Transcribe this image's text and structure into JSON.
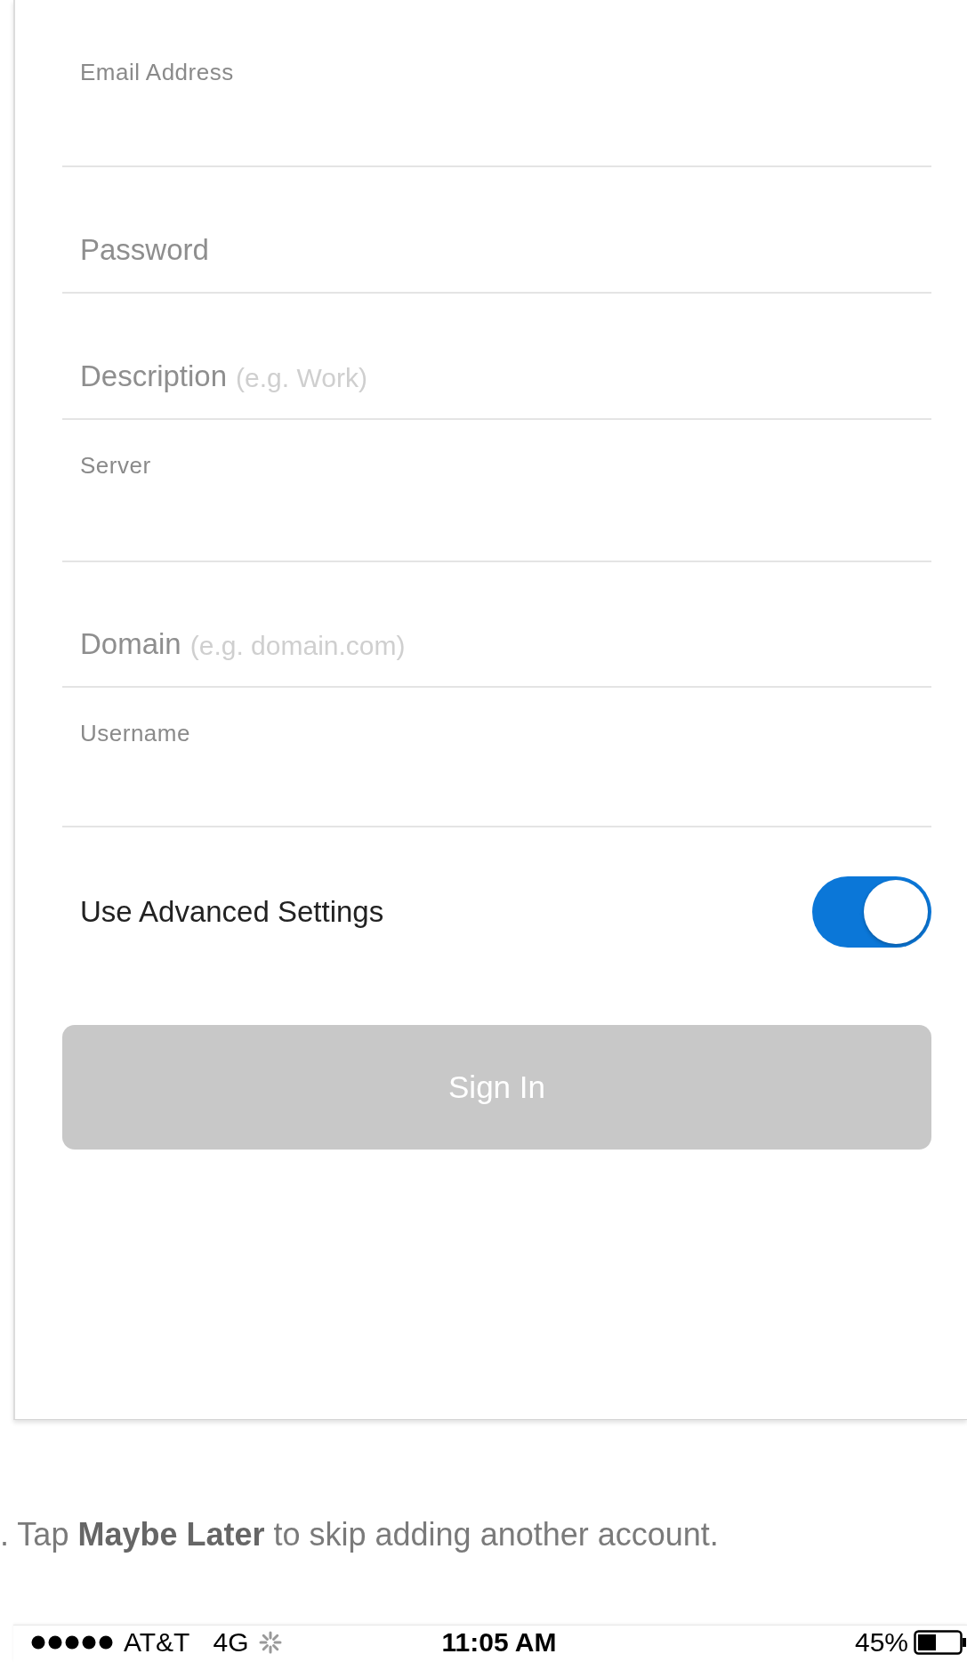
{
  "form": {
    "fields": [
      {
        "kind": "floating",
        "label": "Email Address"
      },
      {
        "kind": "placeholder",
        "placeholder": "Password"
      },
      {
        "kind": "placeholder",
        "placeholder": "Description",
        "hint": "(e.g. Work)"
      },
      {
        "kind": "floating",
        "label": "Server"
      },
      {
        "kind": "placeholder",
        "placeholder": "Domain",
        "hint": "(e.g. domain.com)"
      },
      {
        "kind": "floating",
        "label": "Username"
      }
    ],
    "advanced_toggle": {
      "label": "Use Advanced Settings",
      "on": true
    },
    "sign_in_button": {
      "label": "Sign In",
      "disabled": true
    }
  },
  "instruction": ". Tap **Maybe Later** to skip adding another account.",
  "status_bar": {
    "carrier": "AT&T",
    "network": "4G",
    "time": "11:05 AM",
    "battery": "45%"
  }
}
